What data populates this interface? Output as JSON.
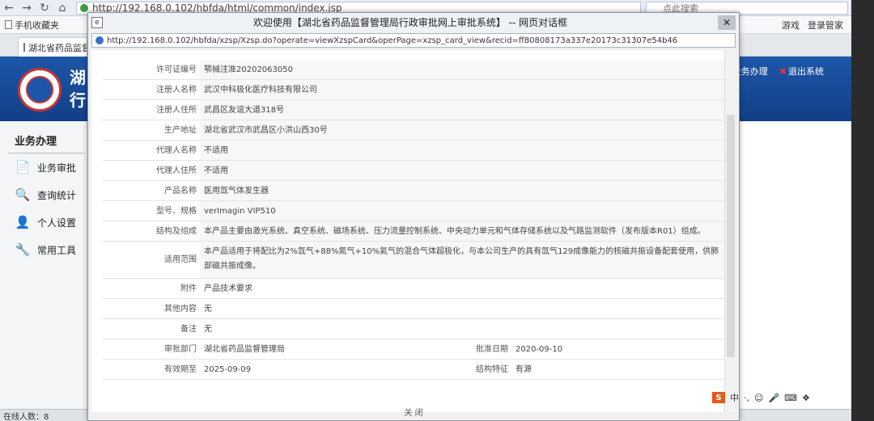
{
  "browser": {
    "address_url": "http://192.168.0.102/hbfda/html/common/index.jsp",
    "search_placeholder": "点此搜索",
    "favorites": [
      "手机收藏夹"
    ],
    "tab_title": "湖北省药品监督",
    "toolbar_games": "游戏",
    "toolbar_login": "登录管家"
  },
  "app": {
    "header_title": "湖 行",
    "header_links": [
      "业务办理",
      "退出系统"
    ],
    "sidebar_title": "业务办理",
    "sidebar_items": [
      {
        "label": "业务审批",
        "icon": "document-icon"
      },
      {
        "label": "查询统计",
        "icon": "search-icon"
      },
      {
        "label": "个人设置",
        "icon": "user-icon"
      },
      {
        "label": "常用工具",
        "icon": "tools-icon"
      }
    ],
    "status": "在线人数：8"
  },
  "dialog": {
    "title": "欢迎使用【湖北省药品监督管理局行政审批网上审批系统】 -- 网页对话框",
    "url": "http://192.168.0.102/hbfda/xzsp/Xzsp.do?operate=viewXzspCard&operPage=xzsp_card_view&recid=ff80808173a337e20173c31307e54b46",
    "fields": [
      {
        "label": "许可证编号",
        "value": "鄂械注准20202063050"
      },
      {
        "label": "注册人名称",
        "value": "武汉中科极化医疗科技有限公司"
      },
      {
        "label": "注册人住所",
        "value": "武昌区友谊大道318号"
      },
      {
        "label": "生产地址",
        "value": "湖北省武汉市武昌区小洪山西30号"
      },
      {
        "label": "代理人名称",
        "value": "不适用"
      },
      {
        "label": "代理人住所",
        "value": "不适用"
      },
      {
        "label": "产品名称",
        "value": "医用氙气体发生器"
      },
      {
        "label": "型号、规格",
        "value": "verImagin VIP510"
      },
      {
        "label": "结构及组成",
        "value": "本产品主要由激光系统、真空系统、磁场系统、压力流量控制系统、中央动力单元和气体存储系统以及气路监测软件（发布版本R01）组成。"
      },
      {
        "label": "适用范围",
        "value": "本产品适用于将配比为2%氙气+88%氮气+10%氦气的混合气体超极化，与本公司生产的具有氙气129成像能力的核磁共振设备配套使用，供肺部磁共振成像。"
      },
      {
        "label": "附件",
        "value": "产品技术要求"
      },
      {
        "label": "其他内容",
        "value": "无"
      },
      {
        "label": "备注",
        "value": "无"
      }
    ],
    "approval_dept_label": "审批部门",
    "approval_dept": "湖北省药品监督管理局",
    "approval_date_label": "批准日期",
    "approval_date": "2020-09-10",
    "valid_until_label": "有效期至",
    "valid_until": "2025-09-09",
    "status_label": "结构特征",
    "status_value": "有源",
    "close_label": "关 闭"
  },
  "ime": {
    "brand": "S",
    "lang": "中"
  }
}
